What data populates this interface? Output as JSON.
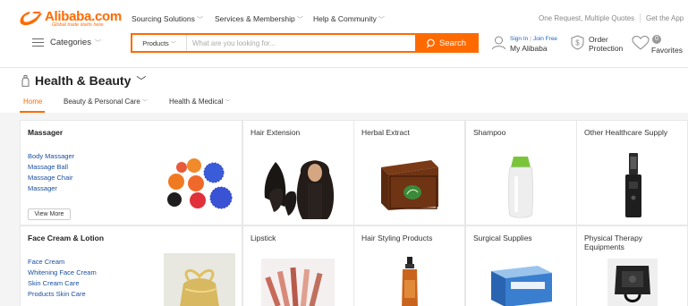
{
  "header": {
    "logo_text": "Alibaba.com",
    "logo_tagline": "Global trade starts here.",
    "nav": [
      {
        "label": "Sourcing Solutions"
      },
      {
        "label": "Services & Membership"
      },
      {
        "label": "Help & Community"
      }
    ],
    "right_links": [
      "One Request, Multiple Quotes",
      "Get the App"
    ]
  },
  "search": {
    "categories_label": "Categories",
    "category_select": "Products",
    "placeholder": "What are you looking for...",
    "button_label": "Search"
  },
  "user": {
    "sign_in": "Sign In",
    "join_free": "Join Free",
    "my_alibaba": "My Alibaba",
    "orders_line1": "Order",
    "orders_line2": "Protection",
    "favorites_count": "0",
    "favorites_label": "Favorites"
  },
  "category": {
    "title": "Health & Beauty",
    "subnav": [
      {
        "label": "Home",
        "active": true
      },
      {
        "label": "Beauty & Personal Care",
        "active": false
      },
      {
        "label": "Health & Medical",
        "active": false
      }
    ]
  },
  "grid": {
    "row1": {
      "feature": {
        "title": "Massager",
        "links": [
          "Body Massager",
          "Massage Ball",
          "Massage Chair",
          "Massager"
        ],
        "view_more": "View More"
      },
      "items": [
        "Hair Extension",
        "Herbal Extract",
        "Shampoo",
        "Other Healthcare Supply"
      ]
    },
    "row2": {
      "feature": {
        "title": "Face Cream & Lotion",
        "links": [
          "Face Cream",
          "Whitening Face Cream",
          "Skin Cream Care",
          "Products Skin Care"
        ]
      },
      "items": [
        "Lipstick",
        "Hair Styling Products",
        "Surgical Supplies",
        "Physical Therapy Equipments"
      ]
    }
  },
  "colors": {
    "brand": "#ff6a00",
    "link": "#1a4fa0"
  }
}
